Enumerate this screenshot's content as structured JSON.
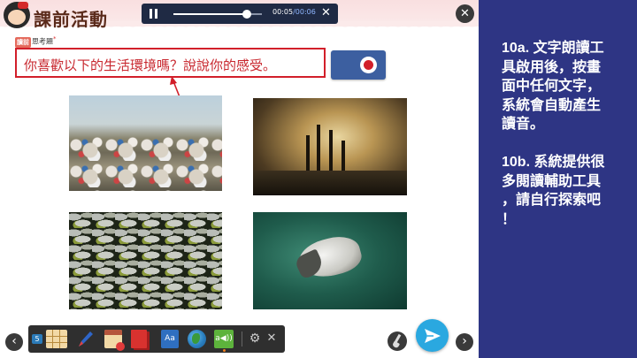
{
  "header": {
    "lesson_title": "課前活動",
    "mascot_icon": "girl-mascot-icon"
  },
  "audio_player": {
    "current_time": "00:05",
    "duration": "/00:06",
    "progress": 0.83,
    "close_label": "✕",
    "pause_icon": "pause-icon"
  },
  "stage_close_label": "✕",
  "section_badge": {
    "prefix": "讀前",
    "label": "思考題",
    "mark": "*"
  },
  "question": "你喜歡以下的生活環境嗎？說說你的感受。",
  "record_button": {
    "icon": "record-icon",
    "color": "#d21f2a"
  },
  "images": [
    {
      "subject": "landfill-garbage-image"
    },
    {
      "subject": "factory-smoke-pollution-image"
    },
    {
      "subject": "dead-fish-water-image"
    },
    {
      "subject": "oil-covered-bird-image"
    }
  ],
  "navigation": {
    "prev_label": "‹",
    "next_label": "›"
  },
  "toolbar": {
    "page_number": "5",
    "dictionary_label": "Aa",
    "speak_label": "a◀))",
    "gear_label": "⚙",
    "close_label": "✕",
    "tools": [
      "grid-icon",
      "pen-icon",
      "calendar-icon",
      "bookmark-icon",
      "dictionary-icon",
      "globe-icon",
      "text-to-speech-icon",
      "settings-icon",
      "close-icon"
    ]
  },
  "instructions": {
    "text": "10a. 文字朗讀工\n具啟用後，按畫\n面中任何文字，\n系統會自動產生\n讀音。\n\n10b. 系統提供很\n多閱讀輔助工具\n，請自行探索吧\n！"
  },
  "colors": {
    "panel_bg": "#2e3584",
    "accent_red": "#d21f2a",
    "send_blue": "#2aa8e0",
    "audio_bg": "#1f2a44"
  }
}
